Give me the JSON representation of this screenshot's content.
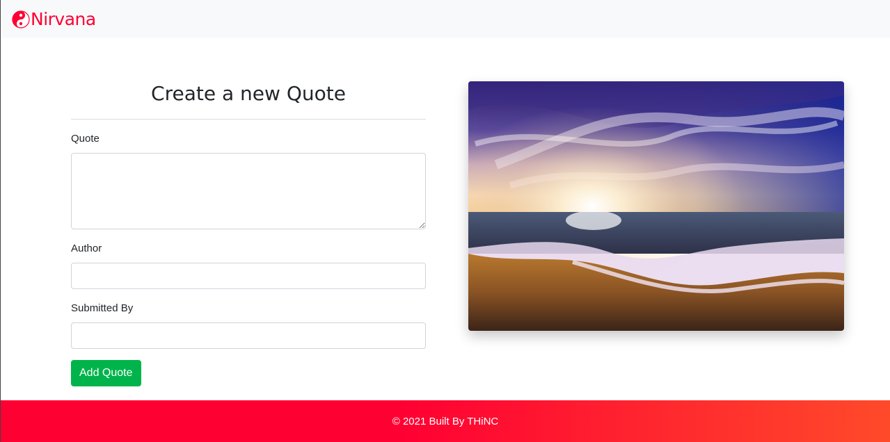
{
  "navbar": {
    "brand_name": "Nirvana",
    "brand_icon": "yin-yang-icon",
    "brand_color": "#ff0033"
  },
  "form": {
    "title": "Create a new Quote",
    "quote_label": "Quote",
    "quote_value": "",
    "author_label": "Author",
    "author_value": "",
    "submitted_by_label": "Submitted By",
    "submitted_by_value": "",
    "submit_label": "Add Quote",
    "submit_color": "#00b44b"
  },
  "image": {
    "subject": "beach-sunset-photo"
  },
  "footer": {
    "text": "© 2021 Built By THiNC",
    "gradient_start": "#ff0033",
    "gradient_end": "#ff4a2a"
  }
}
